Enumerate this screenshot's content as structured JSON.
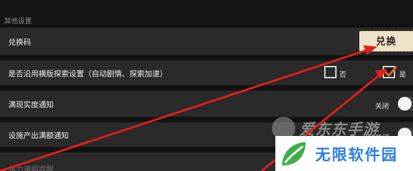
{
  "section": {
    "title": "其他设置"
  },
  "rows": {
    "redeem": {
      "label": "兑换码",
      "button_label": "兑换"
    },
    "landscape": {
      "label": "是否沿用横版探索设置（自动剧情、探索加速）",
      "option_no": "否",
      "option_yes": "是",
      "selected": "是"
    },
    "realtime_notice": {
      "label": "满现实度通知",
      "state_label": "关闭"
    },
    "facility_notice": {
      "label": "设施产出满额通知",
      "state_label": "关闭"
    },
    "partial_row": {
      "label": "体力满额提醒"
    }
  },
  "colors": {
    "annotation_arrow": "#e0201c",
    "checkmark": "#e8602c",
    "watermark_blue": "#2a7de1"
  },
  "watermarks": {
    "top": "爱东东手游",
    "bottom": "无限软件园"
  }
}
